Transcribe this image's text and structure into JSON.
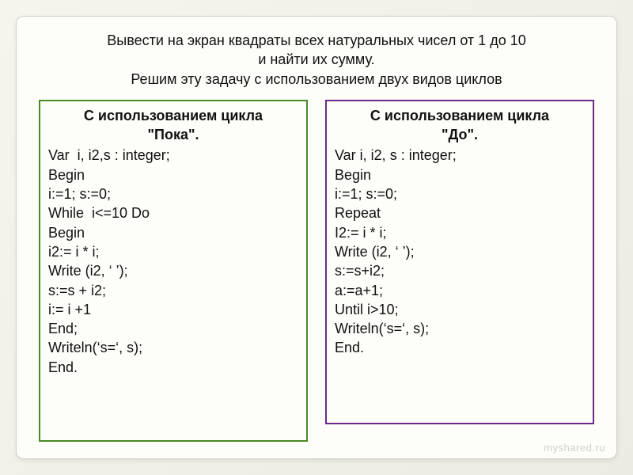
{
  "task": {
    "line1": "Вывести на экран квадраты всех натуральных чисел от 1 до 10",
    "line2": "и найти их сумму.",
    "line3": "Решим эту задачу с использованием двух видов циклов"
  },
  "left": {
    "title_line1": "С использованием цикла",
    "title_line2": "\"Пока\".",
    "code": "Var  i, i2,s : integer;\nBegin\ni:=1; s:=0;\nWhile  i<=10 Do\nBegin\ni2:= i * i;\nWrite (i2, ‘ ’);\ns:=s + i2;\ni:= i +1\nEnd;\nWriteln(‘s=‘, s);\nEnd."
  },
  "right": {
    "title_line1": "С использованием цикла",
    "title_line2": "\"До\".",
    "code": "Var i, i2, s : integer;\nBegin\ni:=1; s:=0;\nRepeat\nI2:= i * i;\nWrite (i2, ‘ ’);\ns:=s+i2;\na:=a+1;\nUntil i>10;\nWriteln(‘s=‘, s);\nEnd."
  },
  "watermark": "myshared.ru",
  "colors": {
    "left_border": "#4a8a27",
    "right_border": "#6b2a8a",
    "slide_bg": "#fdfdf9"
  }
}
